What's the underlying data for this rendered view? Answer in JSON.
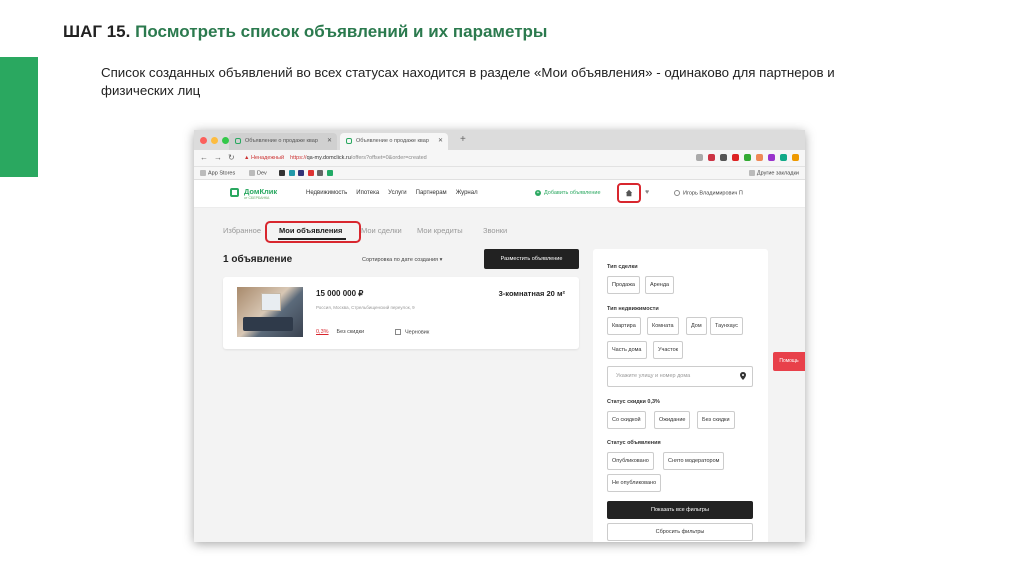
{
  "slide": {
    "step_label": "ШАГ 15.",
    "title": "Посмотреть список объявлений и их параметры",
    "description": "Список созданных объявлений во всех статусах находится в разделе «Мои объявления»  - одинаково для партнеров и физических лиц",
    "accent_color": "#2aa860"
  },
  "browser": {
    "tabs": [
      {
        "label": "Объявление о продаже квар"
      },
      {
        "label": "Объявление о продаже квар"
      }
    ],
    "url": {
      "security": "Ненадежный",
      "scheme": "https://",
      "host": "qa-my.domclick.ru",
      "path": "/offers?offset=0&order=created"
    },
    "bookmarks": [
      "App Stores",
      "Dev",
      "Другие закладки"
    ]
  },
  "site": {
    "logo": "ДомКлик",
    "logo_sub": "от СБЕРБАНКА",
    "menu": [
      "Недвижимость",
      "Ипотека",
      "Услуги",
      "Партнерам",
      "Журнал"
    ],
    "post_link": "Добавить объявление",
    "user_name": "Игорь Владимирович П",
    "subtabs": {
      "favorites": "Избранное",
      "my_listings": "Мои объявления",
      "my_deals": "Мои сделки",
      "my_credits": "Мои кредиты",
      "calls": "Звонки"
    },
    "listing_count": "1 объявление",
    "sort_label": "Сортировка по дате создания",
    "post_button": "Разместить объявление",
    "listing": {
      "price": "15 000 000 ₽",
      "rooms_area": "3-комнатная 20 м²",
      "address": "Россия, Москва, Стрельбищенский переулок, 9",
      "discount_pct": "0,3%",
      "discount_label": "Без скидки",
      "status": "Черновик"
    },
    "filters": {
      "deal_type_label": "Тип сделки",
      "deal_types": [
        "Продажа",
        "Аренда"
      ],
      "property_type_label": "Тип недвижимости",
      "property_types": [
        "Квартира",
        "Комната",
        "Дом",
        "Таунхаус",
        "Часть дома",
        "Участок"
      ],
      "address_placeholder": "Укажите улицу и номер дома",
      "discount_status_label": "Статус скидки 0,3%",
      "discount_statuses": [
        "Со скидкой",
        "Ожидание",
        "Без скидки"
      ],
      "listing_status_label": "Статус объявления",
      "listing_statuses": [
        "Опубликовано",
        "Снято модератором",
        "Не опубликовано"
      ],
      "show_all": "Показать все фильтры",
      "reset": "Сбросить фильтры"
    },
    "help": "Помощь"
  }
}
